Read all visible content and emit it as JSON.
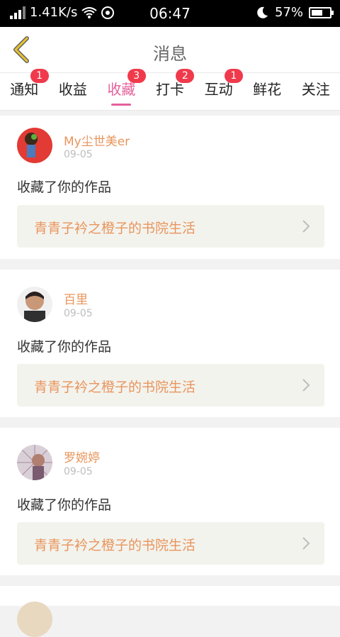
{
  "status_bar": {
    "network_speed": "1.41K/s",
    "time": "06:47",
    "battery": "57%"
  },
  "header": {
    "title": "消息"
  },
  "tabs": [
    {
      "label": "通知",
      "badge": "1"
    },
    {
      "label": "收益",
      "badge": ""
    },
    {
      "label": "收藏",
      "badge": "3",
      "active": true
    },
    {
      "label": "打卡",
      "badge": "2"
    },
    {
      "label": "互动",
      "badge": "1"
    },
    {
      "label": "鲜花",
      "badge": ""
    },
    {
      "label": "关注",
      "badge": ""
    }
  ],
  "messages": [
    {
      "name": "My尘世美er",
      "date": "09-05",
      "text": "收藏了你的作品",
      "work_title": "青青子衿之橙子的书院生活"
    },
    {
      "name": "百里",
      "date": "09-05",
      "text": "收藏了你的作品",
      "work_title": "青青子衿之橙子的书院生活"
    },
    {
      "name": "罗婉婷",
      "date": "09-05",
      "text": "收藏了你的作品",
      "work_title": "青青子衿之橙子的书院生活"
    }
  ],
  "colors": {
    "accent": "#e6609b",
    "badge": "#f03a4c",
    "name": "#e8955c"
  }
}
